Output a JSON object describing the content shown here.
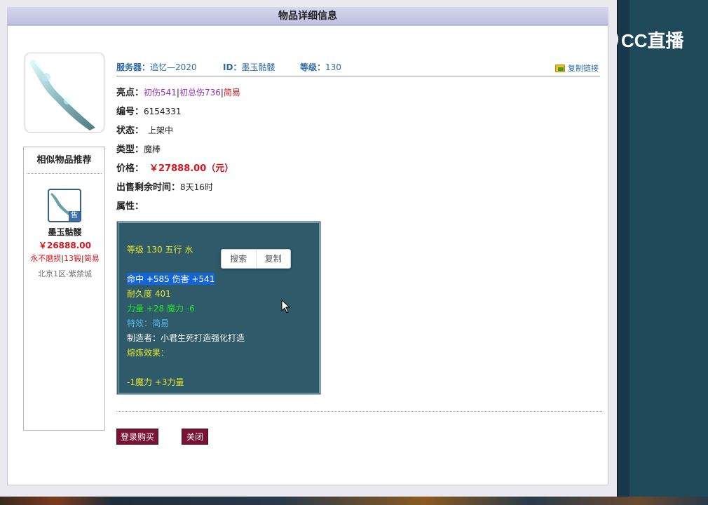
{
  "dialog": {
    "title": "物品详细信息"
  },
  "header": {
    "server_label": "服务器：",
    "server_value": "追忆—2020",
    "id_label": "ID：",
    "id_value": "墨玉骷髅",
    "level_label": "等级：",
    "level_value": "130",
    "copy_link": "复制链接"
  },
  "props": {
    "highlight_label": "亮点：",
    "highlights": [
      "初伤541",
      "初总伤736",
      "简易"
    ],
    "number_label": "编号：",
    "number_value": "6154331",
    "status_label": "状态：",
    "status_value": "上架中",
    "type_label": "类型：",
    "type_value": "魔棒",
    "price_label": "价格：",
    "price_value": "￥27888.00（元）",
    "remaining_label": "出售剩余时间：",
    "remaining_value": "8天16时",
    "attr_label": "属性："
  },
  "attributes": {
    "line1": "等级 130 五行 水",
    "line2": "命中 +585 伤害 +541",
    "line3": "耐久度 401",
    "line4": "力量 +28 魔力 -6",
    "line5": "特效：简易",
    "line6": "制造者：小君生死打造强化打造",
    "line7": "熔炼效果：",
    "line8": "-1魔力 +3力量"
  },
  "context_menu": {
    "search": "搜索",
    "copy": "复制"
  },
  "similar": {
    "title": "相似物品推荐",
    "item": {
      "name": "墨玉骷髅",
      "price": "￥26888.00",
      "tags": [
        "永不磨损",
        "13锻",
        "简易"
      ],
      "server": "北京1区-紫禁城",
      "badge": "售"
    }
  },
  "buttons": {
    "buy": "登录购买",
    "close": "关闭"
  },
  "overlay": {
    "logo_text": "CC直播"
  },
  "colors": {
    "accent": "#7a1236",
    "link": "#2b6aa6",
    "price": "#d8141c",
    "panel": "#2e5a6a"
  }
}
